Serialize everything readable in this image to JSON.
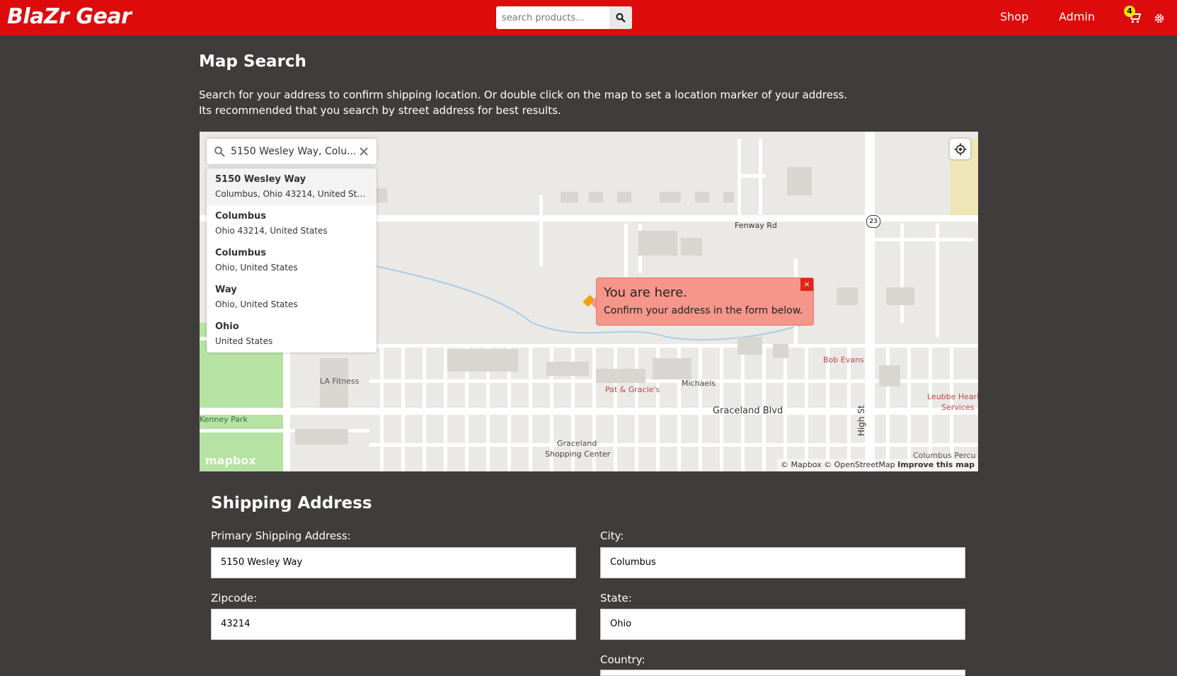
{
  "nav": {
    "brand": "BlaZr Gear",
    "search_placeholder": "search products...",
    "links": [
      "Shop",
      "Admin"
    ],
    "cart_count": "4"
  },
  "page": {
    "title": "Map Search",
    "desc_line1": "Search for your address to confirm shipping location. Or double click on the map to set a location marker of your address.",
    "desc_line2": "Its recommended that you search by street address for best results."
  },
  "map": {
    "search_value": "5150 Wesley Way, Colu...",
    "suggestions": [
      {
        "title": "5150 Wesley Way",
        "sub": "Columbus, Ohio 43214, United Sta..."
      },
      {
        "title": "Columbus",
        "sub": "Ohio 43214, United States"
      },
      {
        "title": "Columbus",
        "sub": "Ohio, United States"
      },
      {
        "title": "Way",
        "sub": "Ohio, United States"
      },
      {
        "title": "Ohio",
        "sub": "United States"
      }
    ],
    "popup_title": "You are here.",
    "popup_sub": "Confirm your address in the form below.",
    "popup_close": "×",
    "labels": {
      "fenway": "Fenway Rd",
      "graceland_blvd": "Graceland Blvd",
      "high_st": "High St",
      "la_fitness": "LA Fitness",
      "kenney_park": "Kenney Park",
      "michaels": "Michaels",
      "pat_gracie": "Pat & Gracie's",
      "bob_evans": "Bob Evans",
      "graceland_sc_1": "Graceland",
      "graceland_sc_2": "Shopping Center",
      "leubbe_1": "Leubbe Hearin",
      "leubbe_2": "Services",
      "columbus_perc": "Columbus Percu",
      "route": "23"
    },
    "logo": "mapbox",
    "attribution": "© Mapbox © OpenStreetMap",
    "improve": "Improve this map"
  },
  "form": {
    "section_title": "Shipping Address",
    "address_label": "Primary Shipping Address:",
    "address_value": "5150 Wesley Way",
    "city_label": "City:",
    "city_value": "Columbus",
    "zip_label": "Zipcode:",
    "zip_value": "43214",
    "state_label": "State:",
    "state_value": "Ohio",
    "country_label": "Country:"
  },
  "colors": {
    "navbar": "#dd0b0b",
    "background": "#403c3c",
    "popup": "#f6958a",
    "badge": "#f5e400"
  }
}
